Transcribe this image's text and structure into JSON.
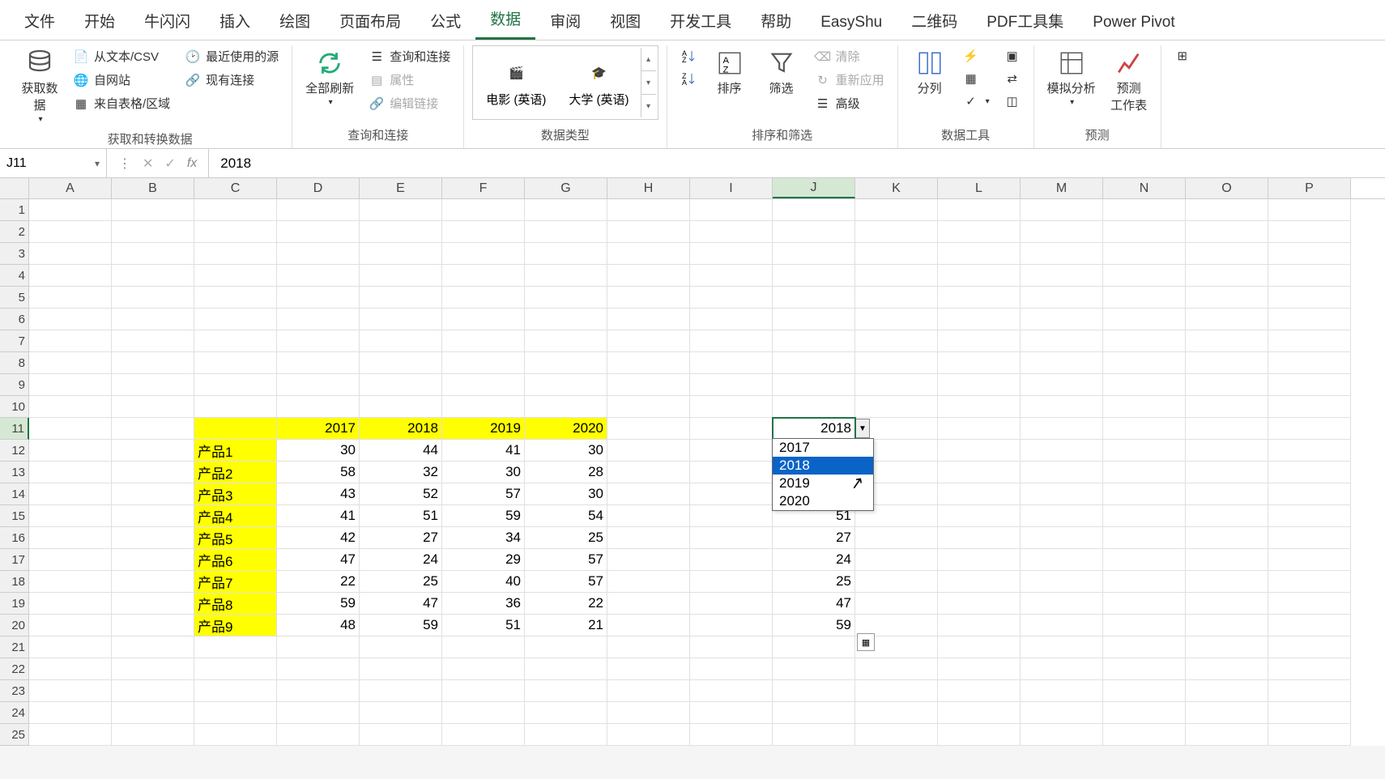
{
  "tabs": {
    "file": "文件",
    "home": "开始",
    "nsn": "牛闪闪",
    "insert": "插入",
    "draw": "绘图",
    "layout": "页面布局",
    "formula": "公式",
    "data": "数据",
    "review": "审阅",
    "view": "视图",
    "dev": "开发工具",
    "help": "帮助",
    "easyshu": "EasyShu",
    "qr": "二维码",
    "pdf": "PDF工具集",
    "pp": "Power Pivot"
  },
  "ribbon": {
    "get_data": "获取数\n据",
    "from_csv": "从文本/CSV",
    "from_web": "自网站",
    "from_table": "来自表格/区域",
    "recent": "最近使用的源",
    "existing": "现有连接",
    "group_get": "获取和转换数据",
    "refresh_all": "全部刷新",
    "queries": "查询和连接",
    "props": "属性",
    "edit_links": "编辑链接",
    "group_queries": "查询和连接",
    "dt_movie": "电影 (英语)",
    "dt_uni": "大学 (英语)",
    "group_datatype": "数据类型",
    "sort": "排序",
    "filter": "筛选",
    "clear": "清除",
    "reapply": "重新应用",
    "advanced": "高级",
    "group_sort": "排序和筛选",
    "text_to_col": "分列",
    "group_tools": "数据工具",
    "whatif": "模拟分析",
    "forecast": "预测\n工作表",
    "group_forecast": "预测"
  },
  "formula_bar": {
    "name_box": "J11",
    "value": "2018"
  },
  "columns": [
    "A",
    "B",
    "C",
    "D",
    "E",
    "F",
    "G",
    "H",
    "I",
    "J",
    "K",
    "L",
    "M",
    "N",
    "O",
    "P"
  ],
  "table": {
    "headers": [
      "2017",
      "2018",
      "2019",
      "2020"
    ],
    "rows": [
      {
        "label": "产品1",
        "v": [
          "30",
          "44",
          "41",
          "30"
        ]
      },
      {
        "label": "产品2",
        "v": [
          "58",
          "32",
          "30",
          "28"
        ]
      },
      {
        "label": "产品3",
        "v": [
          "43",
          "52",
          "57",
          "30"
        ]
      },
      {
        "label": "产品4",
        "v": [
          "41",
          "51",
          "59",
          "54"
        ]
      },
      {
        "label": "产品5",
        "v": [
          "42",
          "27",
          "34",
          "25"
        ]
      },
      {
        "label": "产品6",
        "v": [
          "47",
          "24",
          "29",
          "57"
        ]
      },
      {
        "label": "产品7",
        "v": [
          "22",
          "25",
          "40",
          "57"
        ]
      },
      {
        "label": "产品8",
        "v": [
          "59",
          "47",
          "36",
          "22"
        ]
      },
      {
        "label": "产品9",
        "v": [
          "48",
          "59",
          "51",
          "21"
        ]
      }
    ]
  },
  "j_col": {
    "selected": "2018",
    "dropdown": [
      "2017",
      "2018",
      "2019",
      "2020"
    ],
    "below": [
      "51",
      "27",
      "24",
      "25",
      "47",
      "59"
    ]
  }
}
